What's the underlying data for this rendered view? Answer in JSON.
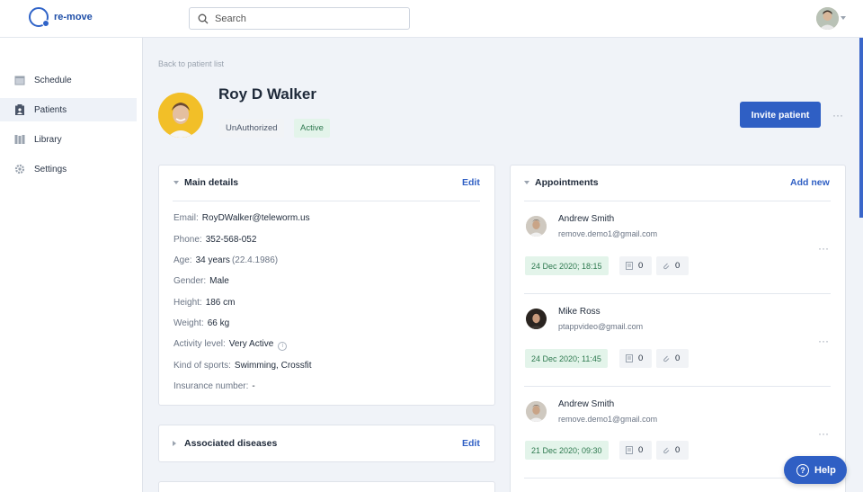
{
  "brand": {
    "name": "re-move",
    "color": "#2f63c8"
  },
  "search": {
    "placeholder": "Search"
  },
  "sidebar": {
    "items": [
      {
        "label": "Schedule",
        "icon": "calendar-icon"
      },
      {
        "label": "Patients",
        "icon": "clipboard-icon",
        "active": true
      },
      {
        "label": "Library",
        "icon": "library-icon"
      },
      {
        "label": "Settings",
        "icon": "gear-icon"
      }
    ]
  },
  "patient": {
    "back_link": "Back to patient list",
    "name": "Roy D Walker",
    "tags": [
      "UnAuthorized",
      "Active"
    ],
    "invite_label": "Invite patient"
  },
  "main_details": {
    "title": "Main details",
    "edit_label": "Edit",
    "rows": [
      {
        "label": "Email:",
        "value": "RoyDWalker@teleworm.us"
      },
      {
        "label": "Phone:",
        "value": "352-568-052"
      },
      {
        "label": "Age:",
        "value": "34 years",
        "sub": "(22.4.1986)"
      },
      {
        "label": "Gender:",
        "value": "Male"
      },
      {
        "label": "Height:",
        "value": "186 cm"
      },
      {
        "label": "Weight:",
        "value": "66 kg"
      },
      {
        "label": "Activity level:",
        "value": "Very Active"
      },
      {
        "label": "Kind of sports:",
        "value": "Swimming, Crossfit"
      },
      {
        "label": "Insurance number:",
        "value": "-"
      }
    ]
  },
  "associated_diseases": {
    "title": "Associated diseases",
    "edit_label": "Edit"
  },
  "appointments": {
    "title": "Appointments",
    "add_label": "Add new",
    "items": [
      {
        "name": "Andrew Smith",
        "email": "remove.demo1@gmail.com",
        "date": "24 Dec 2020; 18:15",
        "docs": "0",
        "attachments": "0"
      },
      {
        "name": "Mike Ross",
        "email": "ptappvideo@gmail.com",
        "date": "24 Dec 2020; 11:45",
        "docs": "0",
        "attachments": "0"
      },
      {
        "name": "Andrew Smith",
        "email": "remove.demo1@gmail.com",
        "date": "21 Dec 2020; 09:30",
        "docs": "0",
        "attachments": "0"
      }
    ]
  },
  "help": {
    "label": "Help"
  }
}
